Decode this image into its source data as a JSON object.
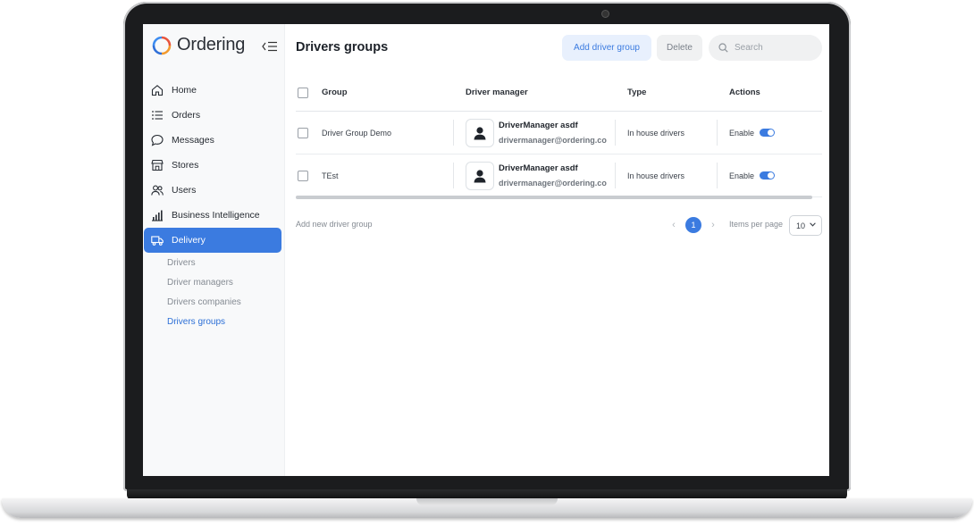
{
  "app": {
    "name": "Ordering"
  },
  "nav": [
    {
      "label": "Home",
      "icon": "home-icon"
    },
    {
      "label": "Orders",
      "icon": "list-icon"
    },
    {
      "label": "Messages",
      "icon": "chat-bubble-icon"
    },
    {
      "label": "Stores",
      "icon": "store-icon"
    },
    {
      "label": "Users",
      "icon": "users-icon"
    },
    {
      "label": "Business Intelligence",
      "icon": "bar-chart-icon"
    },
    {
      "label": "Delivery",
      "icon": "truck-icon",
      "active": true
    }
  ],
  "subnav": [
    {
      "label": "Drivers"
    },
    {
      "label": "Driver managers"
    },
    {
      "label": "Drivers companies"
    },
    {
      "label": "Drivers groups",
      "active": true
    }
  ],
  "page": {
    "title": "Drivers groups"
  },
  "toolbar": {
    "add_label": "Add driver group",
    "delete_label": "Delete",
    "search_placeholder": "Search"
  },
  "table": {
    "headers": {
      "group": "Group",
      "manager": "Driver manager",
      "type": "Type",
      "actions": "Actions"
    },
    "rows": [
      {
        "group": "Driver Group Demo",
        "manager_name": "DriverManager asdf",
        "manager_email": "drivermanager@ordering.co",
        "type": "In house drivers",
        "action_label": "Enable",
        "enabled": true
      },
      {
        "group": "TEst",
        "manager_name": "DriverManager asdf",
        "manager_email": "drivermanager@ordering.co",
        "type": "In house drivers",
        "action_label": "Enable",
        "enabled": true
      }
    ]
  },
  "footer": {
    "add_link": "Add new driver group",
    "current_page": "1",
    "items_per_page_label": "Items per page",
    "items_per_page_value": "10"
  },
  "colors": {
    "accent": "#3b7be0",
    "accent_light": "#e8f0fd",
    "sidebar_bg": "#f8f9fa"
  }
}
